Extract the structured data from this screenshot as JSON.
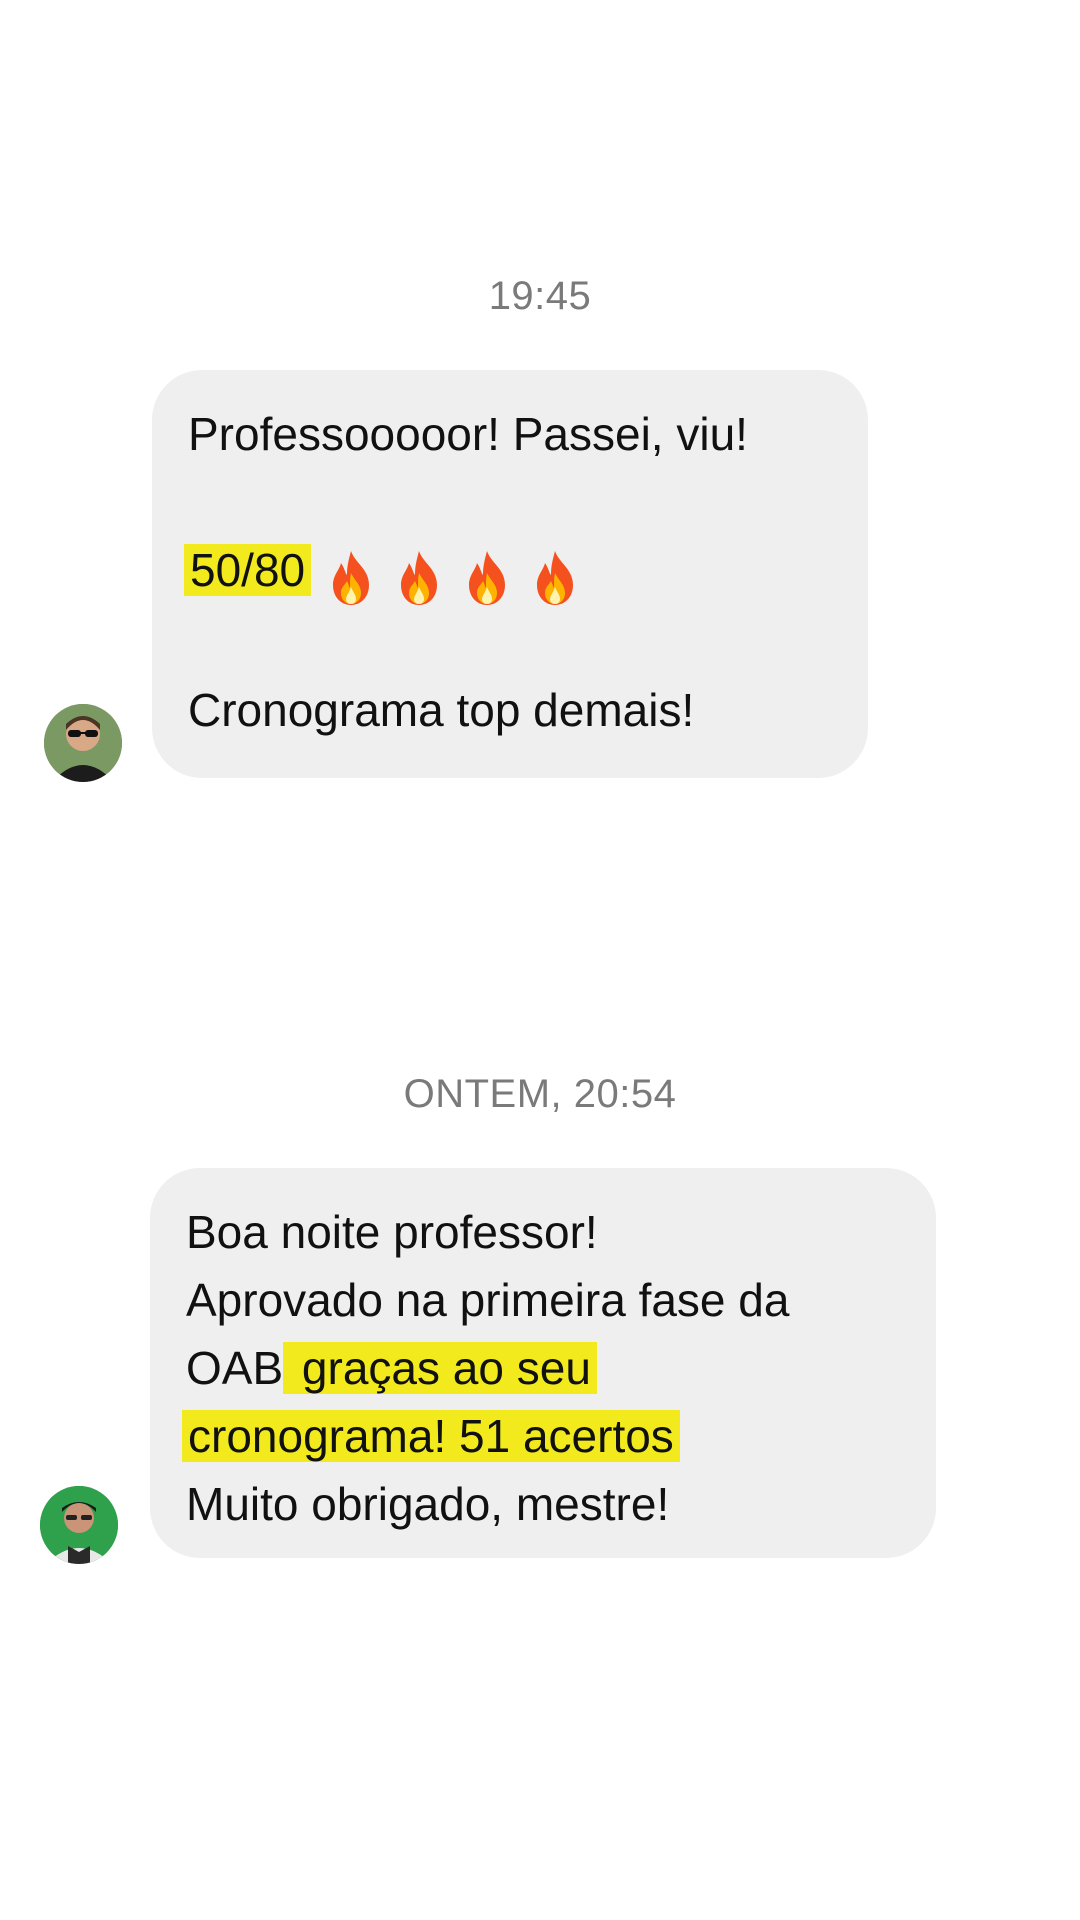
{
  "conversation": [
    {
      "timestamp": "19:45",
      "message": {
        "line1": "Professooooor! Passei, viu!",
        "score": "50/80",
        "fire_icons": [
          "fire-icon",
          "fire-icon",
          "fire-icon",
          "fire-icon"
        ],
        "line3": "Cronograma top demais!"
      }
    },
    {
      "timestamp": "ONTEM, 20:54",
      "message": {
        "line1": "Boa noite professor!",
        "line2": "Aprovado na primeira fase da",
        "line3_plain": "OAB",
        "line3_highlight": " graças ao seu",
        "line4_highlight": "cronograma! 51 acertos",
        "line5": "Muito obrigado, mestre!"
      }
    }
  ],
  "colors": {
    "bubble_bg": "#efefef",
    "highlight": "#f2ea1d",
    "timestamp_text": "#7a7a7a",
    "page_bg": "#ffffff"
  }
}
